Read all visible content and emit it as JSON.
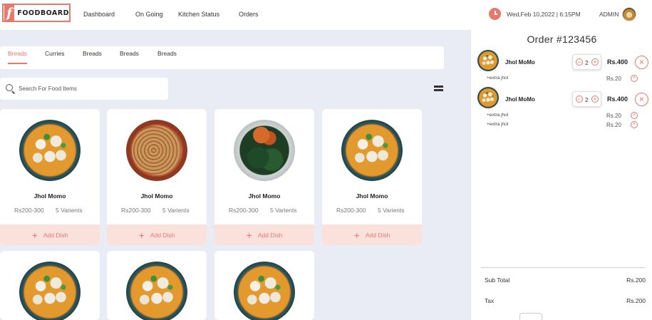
{
  "app": {
    "brand_mark": "f",
    "brand_name": "FOODBOARD"
  },
  "nav": {
    "items": [
      {
        "label": "Dashboard"
      },
      {
        "label": "On Going"
      },
      {
        "label": "Kitchen Status"
      },
      {
        "label": "Orders"
      }
    ]
  },
  "header": {
    "datetime": "Wed,Feb 10,2022 | 6:15PM",
    "user": "ADMIN"
  },
  "tabs": [
    {
      "label": "Breads",
      "active": true
    },
    {
      "label": "Curries",
      "active": false
    },
    {
      "label": "Breads",
      "active": false
    },
    {
      "label": "Breads",
      "active": false
    },
    {
      "label": "Breads",
      "active": false
    }
  ],
  "search": {
    "placeholder": "Search For Food Items",
    "value": ""
  },
  "dishes": [
    {
      "name": "Jhol Momo",
      "price": "Rs200-300",
      "variants": "5 Varients",
      "add_label": "Add Dish",
      "image": "momo"
    },
    {
      "name": "Jhol Momo",
      "price": "Rs200-300",
      "variants": "5 Varients",
      "add_label": "Add Dish",
      "image": "pasta"
    },
    {
      "name": "Jhol Momo",
      "price": "Rs200-300",
      "variants": "5 Varients",
      "add_label": "Add Dish",
      "image": "greens"
    },
    {
      "name": "Jhol Momo",
      "price": "Rs200-300",
      "variants": "5 Varients",
      "add_label": "Add Dish",
      "image": "momo"
    },
    {
      "image": "momo"
    },
    {
      "image": "momo"
    },
    {
      "image": "momo"
    }
  ],
  "order": {
    "title": "Order #123456",
    "items": [
      {
        "name": "Jhol MoMo",
        "qty": "2",
        "price": "Rs.400",
        "extras": [
          {
            "label": "+extra jhol",
            "price": "Rs.20"
          }
        ]
      },
      {
        "name": "Jhol MoMo",
        "qty": "2",
        "price": "Rs.400",
        "extras": [
          {
            "label": "+extra jhol",
            "price": "Rs.20"
          },
          {
            "label": "+extra jhol",
            "price": "Rs.20"
          }
        ]
      }
    ],
    "summary": {
      "subtotal_label": "Sub Total",
      "subtotal_value": "Rs.200",
      "tax_label": "Tax",
      "tax_value": "Rs.200"
    }
  },
  "colors": {
    "accent": "#e8786a",
    "accent_light": "#fbe1dc",
    "background": "#e9ebf5"
  }
}
